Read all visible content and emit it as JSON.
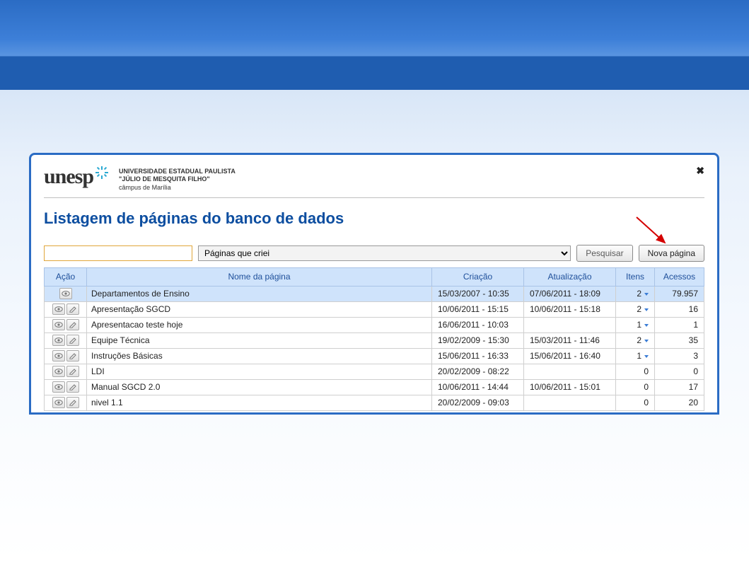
{
  "brand": {
    "name": "unesp",
    "line1": "UNIVERSIDADE ESTADUAL PAULISTA",
    "line2": "\"JÚLIO DE MESQUITA FILHO\"",
    "campus": "câmpus de Marília"
  },
  "page_title": "Listagem de páginas do banco de dados",
  "controls": {
    "filter_value": "",
    "filter_placeholder": "",
    "select_value": "Páginas que criei",
    "search_label": "Pesquisar",
    "newpage_label": "Nova página"
  },
  "columns": {
    "action": "Ação",
    "name": "Nome da página",
    "created": "Criação",
    "updated": "Atualização",
    "items": "Itens",
    "access": "Acessos"
  },
  "rows": [
    {
      "selected": true,
      "edit": false,
      "name": "Departamentos de Ensino",
      "created": "15/03/2007 - 10:35",
      "updated": "07/06/2011 - 18:09",
      "items": "2",
      "items_caret": true,
      "access": "79.957"
    },
    {
      "selected": false,
      "edit": true,
      "name": "Apresentação SGCD",
      "created": "10/06/2011 - 15:15",
      "updated": "10/06/2011 - 15:18",
      "items": "2",
      "items_caret": true,
      "access": "16"
    },
    {
      "selected": false,
      "edit": true,
      "name": "Apresentacao teste hoje",
      "created": "16/06/2011 - 10:03",
      "updated": "",
      "items": "1",
      "items_caret": true,
      "access": "1"
    },
    {
      "selected": false,
      "edit": true,
      "name": "Equipe Técnica",
      "created": "19/02/2009 - 15:30",
      "updated": "15/03/2011 - 11:46",
      "items": "2",
      "items_caret": true,
      "access": "35"
    },
    {
      "selected": false,
      "edit": true,
      "name": "Instruções Básicas",
      "created": "15/06/2011 - 16:33",
      "updated": "15/06/2011 - 16:40",
      "items": "1",
      "items_caret": true,
      "access": "3"
    },
    {
      "selected": false,
      "edit": true,
      "name": "LDI",
      "created": "20/02/2009 - 08:22",
      "updated": "",
      "items": "0",
      "items_caret": false,
      "access": "0"
    },
    {
      "selected": false,
      "edit": true,
      "name": "Manual SGCD 2.0",
      "created": "10/06/2011 - 14:44",
      "updated": "10/06/2011 - 15:01",
      "items": "0",
      "items_caret": false,
      "access": "17"
    },
    {
      "selected": false,
      "edit": true,
      "name": "nivel 1.1",
      "created": "20/02/2009 - 09:03",
      "updated": "",
      "items": "0",
      "items_caret": false,
      "access": "20"
    }
  ]
}
